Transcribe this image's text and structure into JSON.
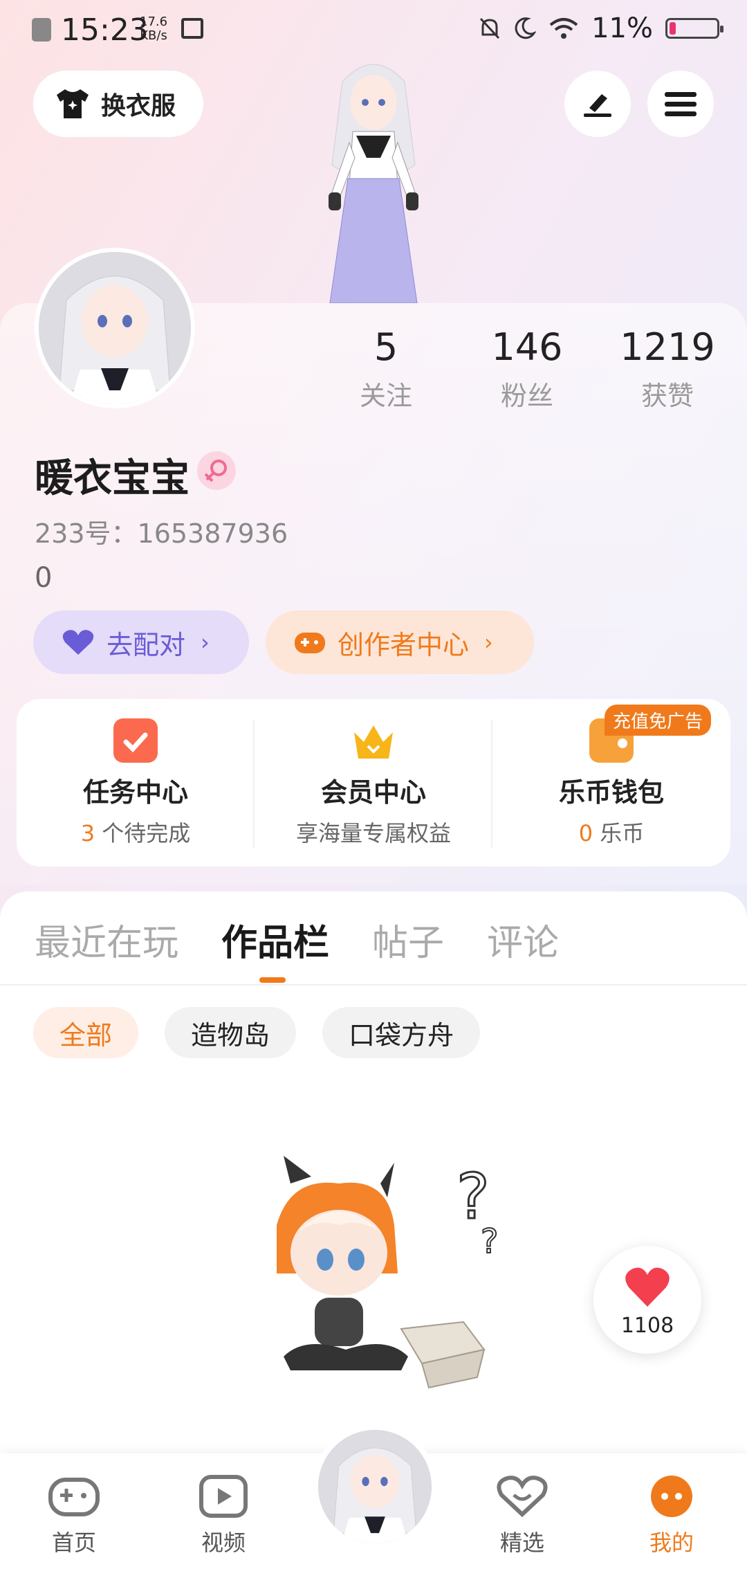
{
  "status_bar": {
    "time": "15:23",
    "speed_value": "17.6",
    "speed_unit": "KB/s",
    "battery": "11%"
  },
  "header": {
    "change_clothes": "换衣服"
  },
  "stats": [
    {
      "value": "5",
      "label": "关注"
    },
    {
      "value": "146",
      "label": "粉丝"
    },
    {
      "value": "1219",
      "label": "获赞"
    }
  ],
  "profile": {
    "nickname": "暖衣宝宝",
    "uid": "233号：165387936",
    "extra": "0"
  },
  "chips": {
    "match": "去配对",
    "creator": "创作者中心"
  },
  "quick": {
    "tasks": {
      "title": "任务中心",
      "count": "3",
      "sub": "个待完成"
    },
    "vip": {
      "title": "会员中心",
      "sub": "享海量专属权益"
    },
    "wallet": {
      "title": "乐币钱包",
      "count": "0",
      "sub": "乐币",
      "badge": "充值免广告"
    }
  },
  "tabs": [
    "最近在玩",
    "作品栏",
    "帖子",
    "评论"
  ],
  "filters": [
    "全部",
    "造物岛",
    "口袋方舟"
  ],
  "like_count": "1108",
  "nav": [
    "首页",
    "视频",
    "精选",
    "我的"
  ],
  "colors": {
    "accent": "#f07a1b",
    "purple": "#6a5bd6"
  }
}
